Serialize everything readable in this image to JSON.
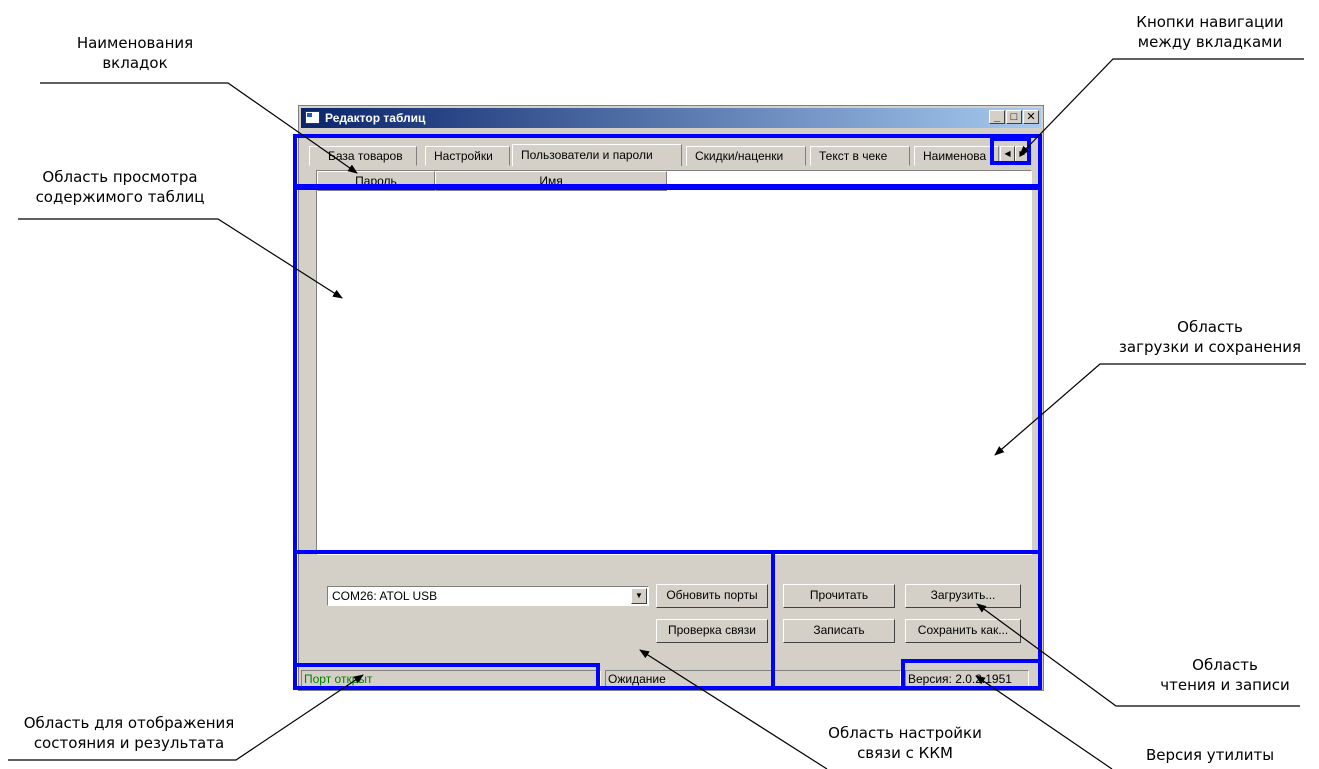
{
  "callouts": {
    "tab_names": [
      "Наименования",
      "вкладок"
    ],
    "tab_nav_buttons": [
      "Кнопки навигации",
      "между вкладками"
    ],
    "table_view": [
      "Область просмотра",
      "содержимого таблиц"
    ],
    "load_save": [
      "Область",
      "загрузки и сохранения"
    ],
    "read_write": [
      "Область",
      "чтения и записи"
    ],
    "status_area": [
      "Область для отображения",
      "состояния и результата"
    ],
    "kkm_connection": [
      "Область настройки",
      "связи с ККМ"
    ],
    "utility_version": [
      "Версия утилиты"
    ]
  },
  "window": {
    "title": "Редактор таблиц",
    "controls": {
      "minimize": "_",
      "maximize": "□",
      "close": "✕"
    }
  },
  "tabs": [
    {
      "label": "База товаров"
    },
    {
      "label": "Настройки"
    },
    {
      "label": "Пользователи и пароли",
      "active": true
    },
    {
      "label": "Скидки/наценки"
    },
    {
      "label": "Текст в чеке"
    },
    {
      "label": "Наименова"
    }
  ],
  "tab_nav": {
    "left": "◀",
    "right": "▶"
  },
  "table": {
    "columns": [
      "Пароль",
      "Имя"
    ]
  },
  "connection": {
    "port": "COM26: ATOL USB",
    "combo_arrow": "▼",
    "refresh_ports_label": "Обновить порты",
    "check_connection_label": "Проверка связи"
  },
  "actions": {
    "read_label": "Прочитать",
    "write_label": "Записать",
    "load_label": "Загрузить...",
    "save_as_label": "Сохранить как..."
  },
  "status": {
    "port_state": "Порт открыт",
    "operation": "Ожидание",
    "version": "Версия: 2.0.2.1951"
  },
  "colors": {
    "highlight": "#0000ff",
    "status_text": "#008000",
    "title_gradient_start": "#0a246a",
    "title_gradient_end": "#a6caf0"
  }
}
